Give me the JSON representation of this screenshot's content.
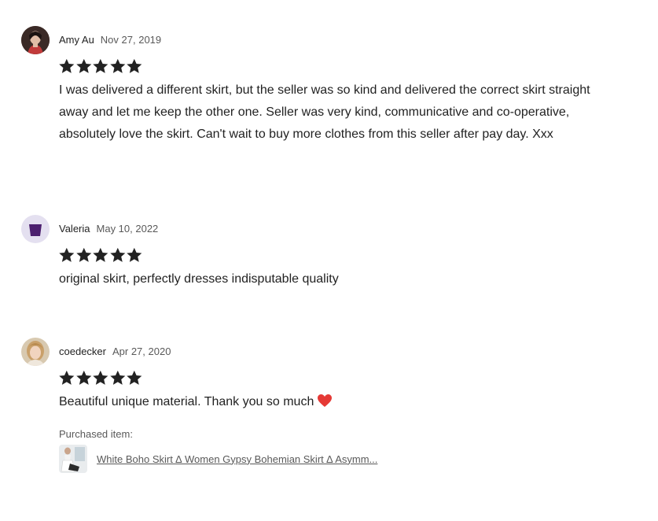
{
  "reviews": [
    {
      "name": "Amy Au",
      "date": "Nov 27, 2019",
      "rating": 5,
      "text": "I was delivered a different skirt, but the seller was so kind and delivered the correct skirt straight away and let me keep the other one. Seller was very kind, communicative and co-operative, absolutely love the skirt. Can't wait to buy more clothes from this seller after pay day. Xxx"
    },
    {
      "name": "Valeria",
      "date": "May 10, 2022",
      "rating": 5,
      "text": "original skirt, perfectly dresses indisputable quality"
    },
    {
      "name": "coedecker",
      "date": "Apr 27, 2020",
      "rating": 5,
      "text": "Beautiful unique material. Thank you so much",
      "purchased_label": "Purchased item:",
      "purchased_item": "White Boho Skirt ∆ Women Gypsy Bohemian Skirt ∆ Asymm..."
    }
  ],
  "colors": {
    "star": "#222222",
    "text": "#222222",
    "muted": "#595959",
    "heart": "#e53935"
  },
  "icons": {
    "star": "star-icon",
    "heart": "heart-emoji-icon"
  }
}
